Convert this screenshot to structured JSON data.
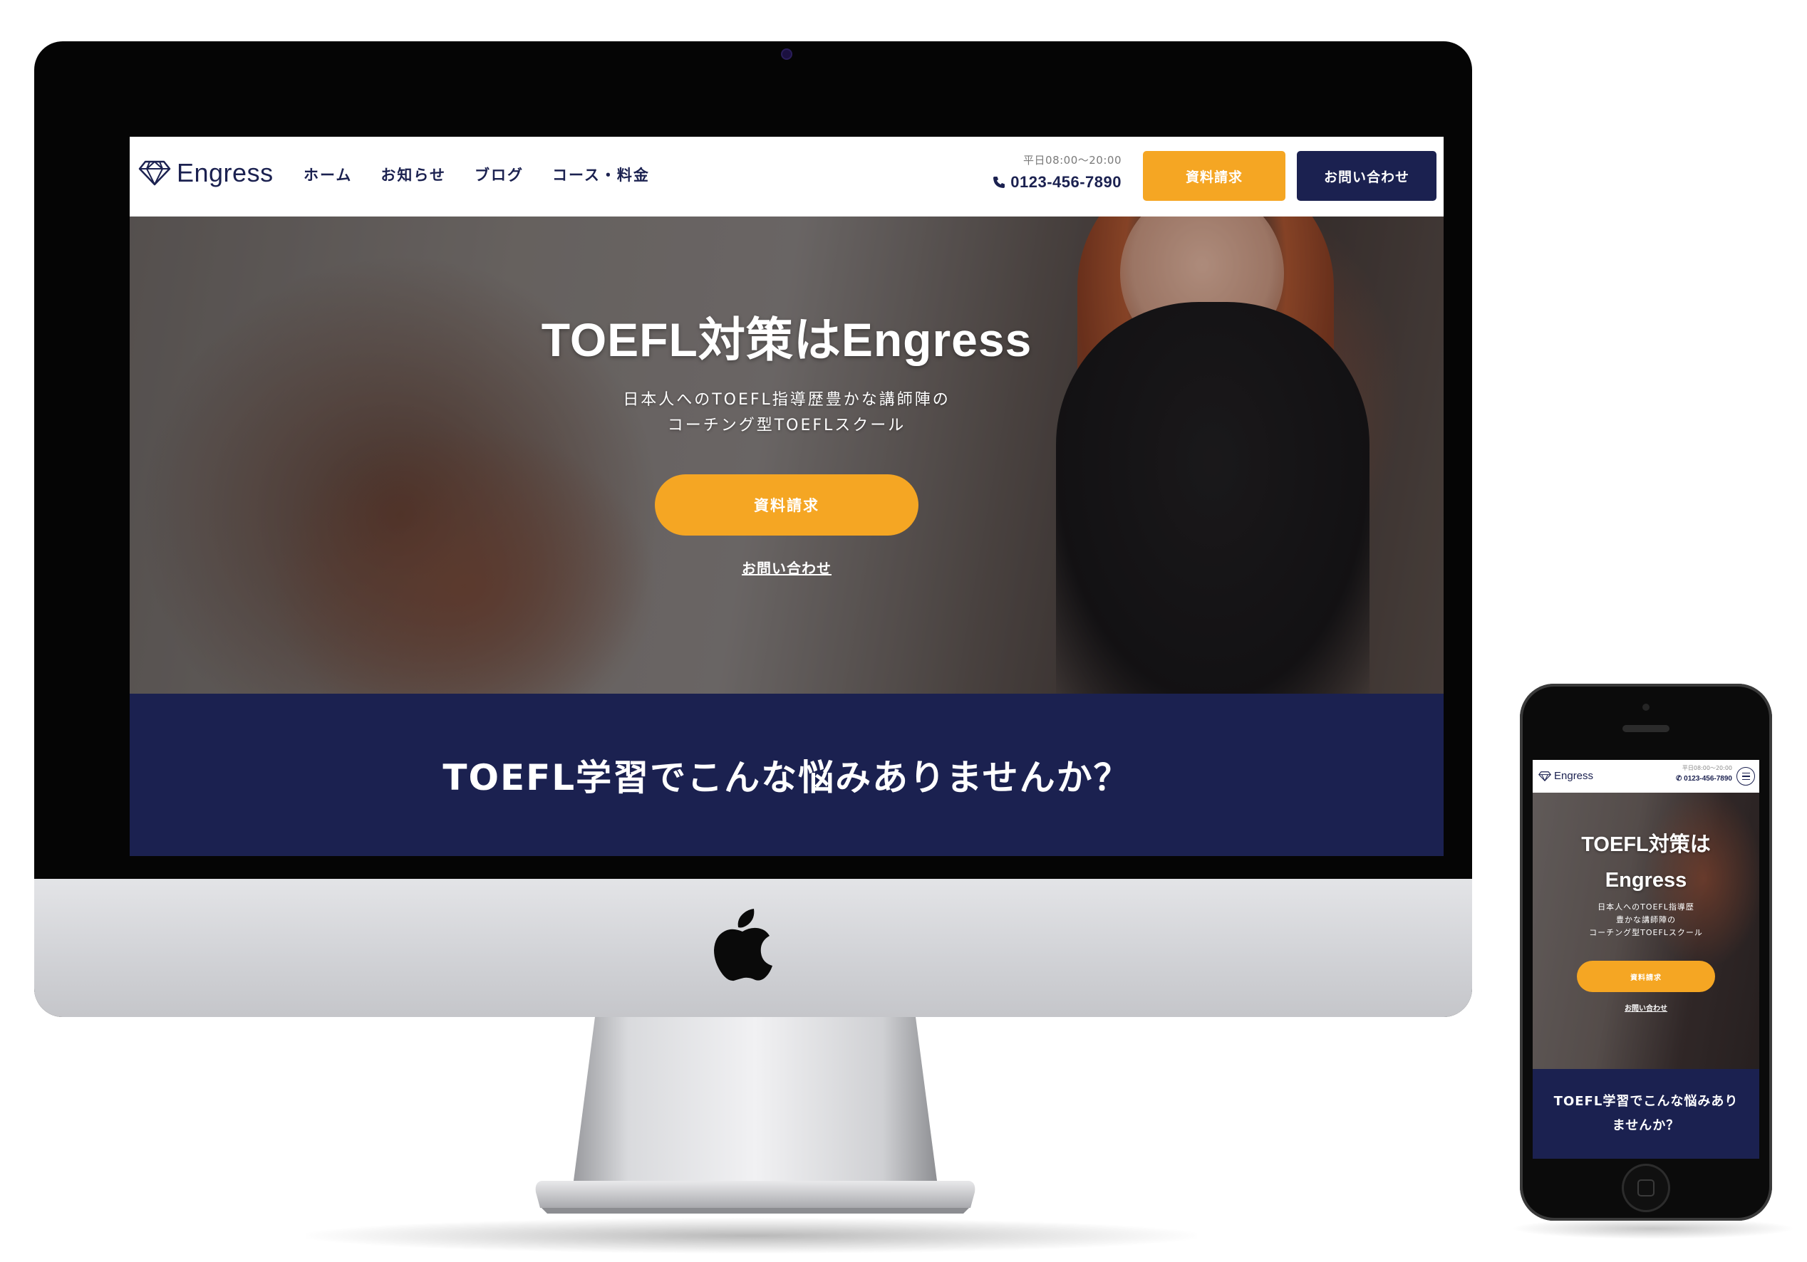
{
  "brand": {
    "name": "Engress"
  },
  "header": {
    "nav": [
      "ホーム",
      "お知らせ",
      "ブログ",
      "コース・料金"
    ],
    "hours": "平日08:00〜20:00",
    "phone": "0123-456-7890",
    "request_button": "資料請求",
    "contact_button": "お問い合わせ"
  },
  "hero": {
    "title": "TOEFL対策はEngress",
    "subtitle_line1": "日本人へのTOEFL指導歴豊かな講師陣の",
    "subtitle_line2": "コーチング型TOEFLスクール",
    "cta_button": "資料請求",
    "contact_link": "お問い合わせ"
  },
  "problems": {
    "title": "TOEFL学習でこんな悩みありませんか？"
  },
  "mobile": {
    "brand": "Engress",
    "hours": "平日08:00〜20:00",
    "phone": "0123-456-7890",
    "hero_title_line1": "TOEFL対策は",
    "hero_title_line2": "Engress",
    "hero_sub_line1": "日本人へのTOEFL指導歴",
    "hero_sub_line2": "豊かな講師陣の",
    "hero_sub_line3": "コーチング型TOEFLスクール",
    "cta_button": "資料請求",
    "contact_link": "お問い合わせ",
    "problems_line1": "TOEFL学習でこんな悩みあり",
    "problems_line2": "ませんか？"
  },
  "colors": {
    "navy": "#1b2150",
    "accent_orange": "#f5a623",
    "white": "#ffffff"
  },
  "icons": [
    "diamond-logo-icon",
    "phone-icon",
    "menu-icon",
    "apple-logo-icon"
  ]
}
